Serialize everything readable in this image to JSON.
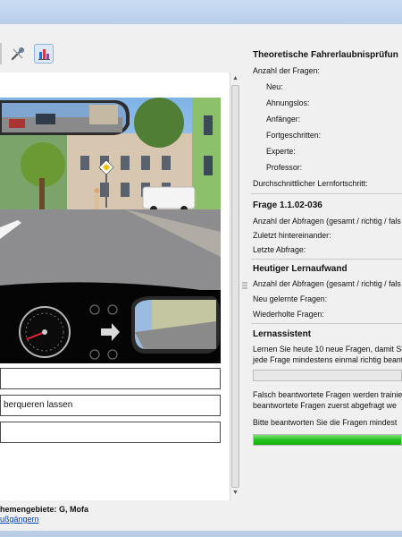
{
  "toolbar": {
    "tools_icon": "tools-icon",
    "stats_icon": "bar-chart-icon"
  },
  "question_media": {
    "description_icon": "driving-scene"
  },
  "answers": [
    {
      "label": ""
    },
    {
      "label": "berqueren lassen"
    },
    {
      "label": ""
    }
  ],
  "footer": {
    "themes": "hemengebiete: G, Mofa",
    "link": "ußgängern"
  },
  "stats": {
    "title": "Theoretische Fahrerlaubnisprüfun",
    "count_label": "Anzahl der Fragen:",
    "levels": [
      "Neu:",
      "Ahnungslos:",
      "Anfänger:",
      "Fortgeschritten:",
      "Experte:",
      "Professor:"
    ],
    "avg_progress": "Durchschnittlicher Lernfortschritt:"
  },
  "question": {
    "title": "Frage 1.1.02-036",
    "queries": "Anzahl der Abfragen (gesamt / richtig / fals",
    "consecutive": "Zuletzt hintereinander:",
    "last": "Letzte Abfrage:"
  },
  "today": {
    "title": "Heutiger Lernaufwand",
    "queries": "Anzahl der Abfragen (gesamt / richtig / fals",
    "new": "Neu gelernte Fragen:",
    "repeated": "Wiederholte Fragen:"
  },
  "assistant": {
    "title": "Lernassistent",
    "text1": "Lernen Sie heute 10 neue Fragen, damit Si",
    "text2": "jede Frage mindestens einmal richtig beant",
    "progress1": 0,
    "text3": "Falsch beantwortete Fragen werden trainie",
    "text4": "beantwortete Fragen zuerst abgefragt we",
    "text5": "Bitte beantworten Sie die Fragen mindest",
    "progress2": 1
  }
}
